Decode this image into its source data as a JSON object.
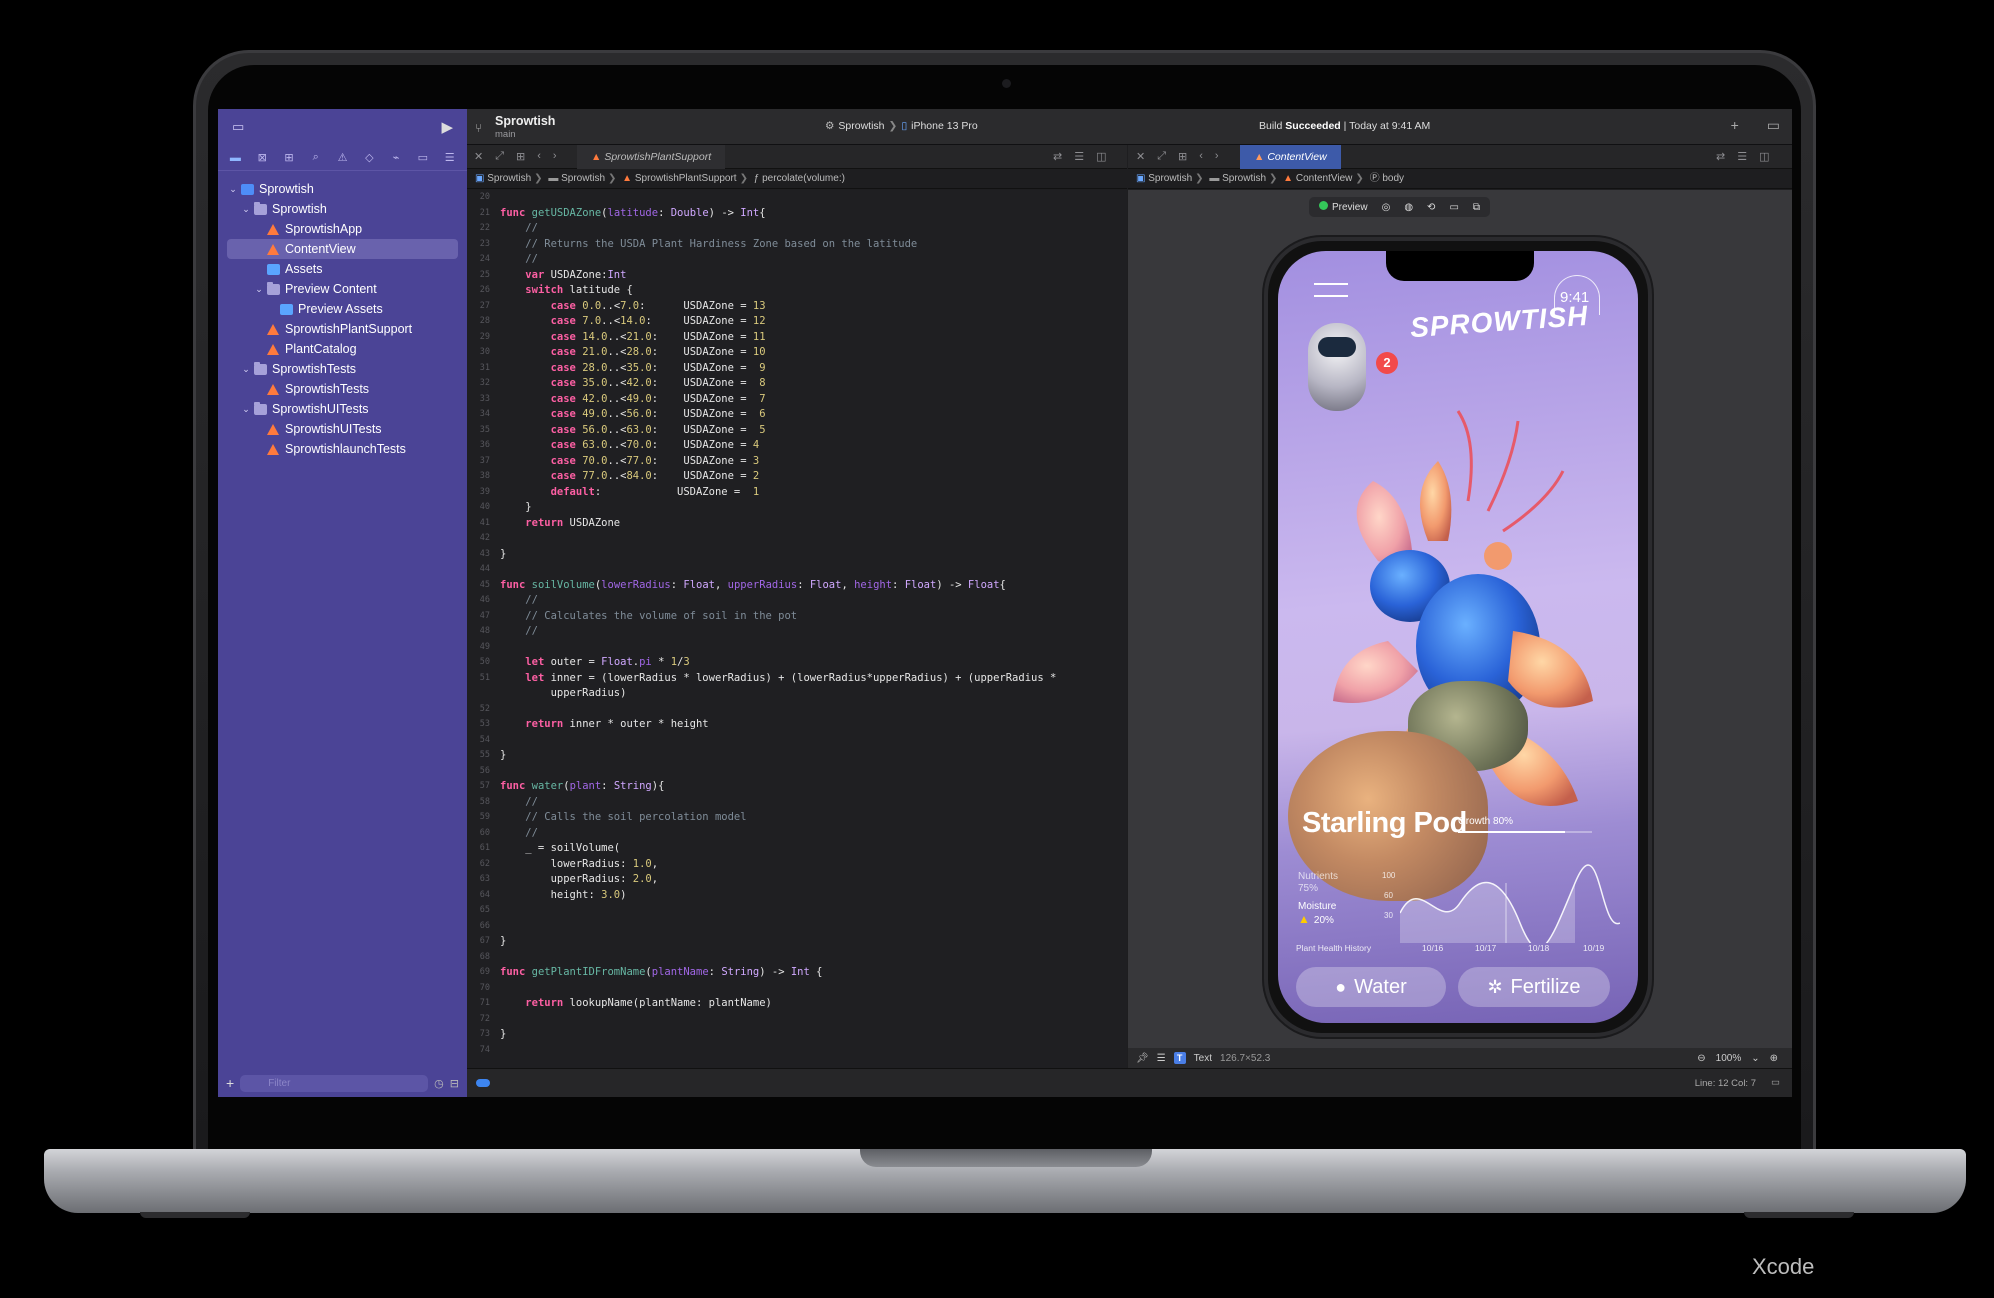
{
  "caption": "Xcode",
  "window": {
    "project": "Sprowtish",
    "branch": "main",
    "scheme_project": "Sprowtish",
    "scheme_device": "iPhone 13 Pro",
    "build_prefix": "Build",
    "build_status": "Succeeded",
    "build_time": "| Today at 9:41 AM"
  },
  "navigator": {
    "filter_placeholder": "Filter",
    "items": [
      {
        "label": "Sprowtish",
        "depth": 0,
        "kind": "project",
        "expanded": true
      },
      {
        "label": "Sprowtish",
        "depth": 1,
        "kind": "folder",
        "expanded": true
      },
      {
        "label": "SprowtishApp",
        "depth": 2,
        "kind": "swift"
      },
      {
        "label": "ContentView",
        "depth": 2,
        "kind": "swift",
        "selected": true
      },
      {
        "label": "Assets",
        "depth": 2,
        "kind": "assets"
      },
      {
        "label": "Preview Content",
        "depth": 2,
        "kind": "folder",
        "expanded": true
      },
      {
        "label": "Preview Assets",
        "depth": 3,
        "kind": "assets"
      },
      {
        "label": "SprowtishPlantSupport",
        "depth": 2,
        "kind": "swift"
      },
      {
        "label": "PlantCatalog",
        "depth": 2,
        "kind": "swift"
      },
      {
        "label": "SprowtishTests",
        "depth": 1,
        "kind": "folder",
        "expanded": true
      },
      {
        "label": "SprowtishTests",
        "depth": 2,
        "kind": "swift"
      },
      {
        "label": "SprowtishUITests",
        "depth": 1,
        "kind": "folder",
        "expanded": true
      },
      {
        "label": "SprowtishUITests",
        "depth": 2,
        "kind": "swift"
      },
      {
        "label": "SprowtishlaunchTests",
        "depth": 2,
        "kind": "swift"
      }
    ]
  },
  "editor": {
    "tab": "SprowtishPlantSupport",
    "jumpbar": [
      "Sprowtish",
      "Sprowtish",
      "SprowtishPlantSupport",
      "percolate(volume:)"
    ],
    "lines": [
      {
        "n": "20",
        "h": ""
      },
      {
        "n": "21",
        "h": "<span class='kw'>func</span> <span class='fn'>getUSDAZone</span>(<span class='pm'>latitude</span>: <span class='ty'>Double</span>) -> <span class='ty'>Int</span>{"
      },
      {
        "n": "22",
        "h": "    <span class='cm'>//</span>"
      },
      {
        "n": "23",
        "h": "    <span class='cm'>// Returns the USDA Plant Hardiness Zone based on the latitude</span>"
      },
      {
        "n": "24",
        "h": "    <span class='cm'>//</span>"
      },
      {
        "n": "25",
        "h": "    <span class='kw'>var</span> USDAZone:<span class='ty'>Int</span>"
      },
      {
        "n": "26",
        "h": "    <span class='kw'>switch</span> latitude {"
      },
      {
        "n": "27",
        "h": "        <span class='kw'>case</span> <span class='num'>0.0</span>..<<span class='num'>7.0</span>:      USDAZone = <span class='num'>13</span>"
      },
      {
        "n": "28",
        "h": "        <span class='kw'>case</span> <span class='num'>7.0</span>..<<span class='num'>14.0</span>:     USDAZone = <span class='num'>12</span>"
      },
      {
        "n": "29",
        "h": "        <span class='kw'>case</span> <span class='num'>14.0</span>..<<span class='num'>21.0</span>:    USDAZone = <span class='num'>11</span>"
      },
      {
        "n": "30",
        "h": "        <span class='kw'>case</span> <span class='num'>21.0</span>..<<span class='num'>28.0</span>:    USDAZone = <span class='num'>10</span>"
      },
      {
        "n": "31",
        "h": "        <span class='kw'>case</span> <span class='num'>28.0</span>..<<span class='num'>35.0</span>:    USDAZone =  <span class='num'>9</span>"
      },
      {
        "n": "32",
        "h": "        <span class='kw'>case</span> <span class='num'>35.0</span>..<<span class='num'>42.0</span>:    USDAZone =  <span class='num'>8</span>"
      },
      {
        "n": "33",
        "h": "        <span class='kw'>case</span> <span class='num'>42.0</span>..<<span class='num'>49.0</span>:    USDAZone =  <span class='num'>7</span>"
      },
      {
        "n": "34",
        "h": "        <span class='kw'>case</span> <span class='num'>49.0</span>..<<span class='num'>56.0</span>:    USDAZone =  <span class='num'>6</span>"
      },
      {
        "n": "35",
        "h": "        <span class='kw'>case</span> <span class='num'>56.0</span>..<<span class='num'>63.0</span>:    USDAZone =  <span class='num'>5</span>"
      },
      {
        "n": "36",
        "h": "        <span class='kw'>case</span> <span class='num'>63.0</span>..<<span class='num'>70.0</span>:    USDAZone = <span class='num'>4</span>"
      },
      {
        "n": "37",
        "h": "        <span class='kw'>case</span> <span class='num'>70.0</span>..<<span class='num'>77.0</span>:    USDAZone = <span class='num'>3</span>"
      },
      {
        "n": "38",
        "h": "        <span class='kw'>case</span> <span class='num'>77.0</span>..<<span class='num'>84.0</span>:    USDAZone = <span class='num'>2</span>"
      },
      {
        "n": "39",
        "h": "        <span class='kw'>default</span>:            USDAZone =  <span class='num'>1</span>"
      },
      {
        "n": "40",
        "h": "    }"
      },
      {
        "n": "41",
        "h": "    <span class='kw'>return</span> USDAZone"
      },
      {
        "n": "42",
        "h": ""
      },
      {
        "n": "43",
        "h": "}"
      },
      {
        "n": "44",
        "h": ""
      },
      {
        "n": "45",
        "h": "<span class='kw'>func</span> <span class='fn'>soilVolume</span>(<span class='pm'>lowerRadius</span>: <span class='ty'>Float</span>, <span class='pm'>upperRadius</span>: <span class='ty'>Float</span>, <span class='pm'>height</span>: <span class='ty'>Float</span>) -> <span class='ty'>Float</span>{"
      },
      {
        "n": "46",
        "h": "    <span class='cm'>//</span>"
      },
      {
        "n": "47",
        "h": "    <span class='cm'>// Calculates the volume of soil in the pot</span>"
      },
      {
        "n": "48",
        "h": "    <span class='cm'>//</span>"
      },
      {
        "n": "49",
        "h": ""
      },
      {
        "n": "50",
        "h": "    <span class='kw'>let</span> outer = <span class='ty'>Float</span>.<span class='pm'>pi</span> * <span class='num'>1</span>/<span class='num'>3</span>"
      },
      {
        "n": "51",
        "h": "    <span class='kw'>let</span> inner = (lowerRadius * lowerRadius) + (lowerRadius*upperRadius) + (upperRadius *"
      },
      {
        "n": "",
        "h": "        upperRadius)"
      },
      {
        "n": "52",
        "h": ""
      },
      {
        "n": "53",
        "h": "    <span class='kw'>return</span> inner * outer * height"
      },
      {
        "n": "54",
        "h": ""
      },
      {
        "n": "55",
        "h": "}"
      },
      {
        "n": "56",
        "h": ""
      },
      {
        "n": "57",
        "h": "<span class='kw'>func</span> <span class='fn'>water</span>(<span class='pm'>plant</span>: <span class='ty'>String</span>){"
      },
      {
        "n": "58",
        "h": "    <span class='cm'>//</span>"
      },
      {
        "n": "59",
        "h": "    <span class='cm'>// Calls the soil percolation model</span>"
      },
      {
        "n": "60",
        "h": "    <span class='cm'>//</span>"
      },
      {
        "n": "61",
        "h": "    _ = soilVolume("
      },
      {
        "n": "62",
        "h": "        lowerRadius: <span class='num'>1.0</span>,"
      },
      {
        "n": "63",
        "h": "        upperRadius: <span class='num'>2.0</span>,"
      },
      {
        "n": "64",
        "h": "        height: <span class='num'>3.0</span>)"
      },
      {
        "n": "65",
        "h": ""
      },
      {
        "n": "66",
        "h": ""
      },
      {
        "n": "67",
        "h": "}"
      },
      {
        "n": "68",
        "h": ""
      },
      {
        "n": "69",
        "h": "<span class='kw'>func</span> <span class='fn'>getPlantIDFromName</span>(<span class='pm'>plantName</span>: <span class='ty'>String</span>) -> <span class='ty'>Int</span> {"
      },
      {
        "n": "70",
        "h": ""
      },
      {
        "n": "71",
        "h": "    <span class='kw'>return</span> lookupName(plantName: plantName)"
      },
      {
        "n": "72",
        "h": ""
      },
      {
        "n": "73",
        "h": "}"
      },
      {
        "n": "74",
        "h": ""
      }
    ]
  },
  "canvas": {
    "tab": "ContentView",
    "jumpbar": [
      "Sprowtish",
      "Sprowtish",
      "ContentView",
      "body"
    ],
    "preview_label": "Preview",
    "selection_type": "Text",
    "selection_size": "126.7×52.3",
    "zoom": "100%"
  },
  "app": {
    "logo": "SPROWTISH",
    "time": "9:41",
    "badge_count": "2",
    "plant_name": "Starling Pod",
    "growth_label": "Growth 80%",
    "growth": 0.8,
    "nutrients_label": "Nutrients",
    "nutrients_value": "75%",
    "moisture_label": "Moisture",
    "moisture_value": "20%",
    "history_label": "Plant Health History",
    "y_ticks": [
      "100",
      "60",
      "30"
    ],
    "x_ticks": [
      "10/16",
      "10/17",
      "10/18",
      "10/19"
    ],
    "water_label": "Water",
    "fertilize_label": "Fertilize"
  },
  "status": {
    "cursor": "Line: 12  Col: 7"
  },
  "colors": {
    "navigator": "#4b4496",
    "accent": "#3d85f0",
    "build_success": "#ffffff"
  }
}
